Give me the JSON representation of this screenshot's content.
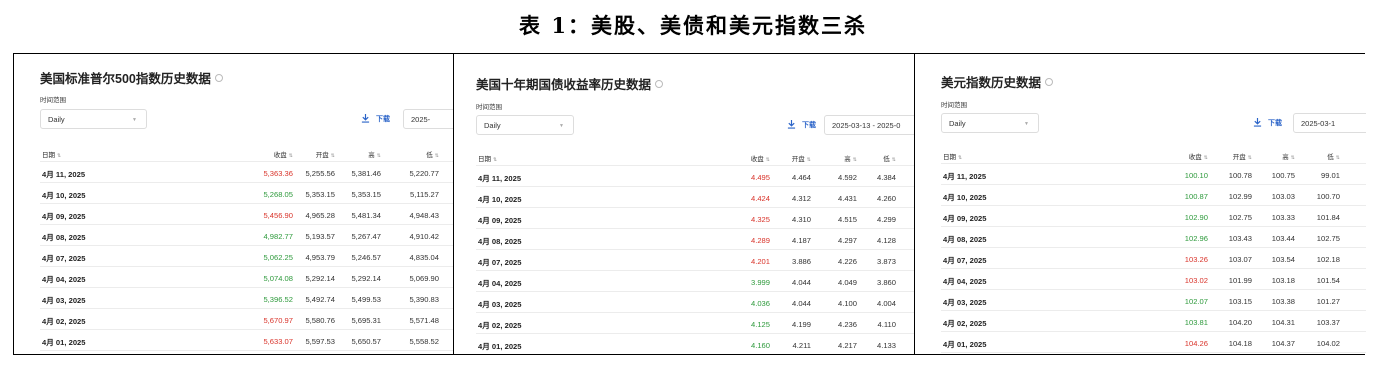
{
  "page_title": "表 1：美股、美债和美元指数三杀",
  "colors": {
    "up": "#d9342b",
    "down": "#2e9a3c",
    "link": "#2a63c8"
  },
  "panels": [
    {
      "title": "美国标准普尔500指数历史数据",
      "range_label": "时间范围",
      "range_value": "Daily",
      "download_label": "下载",
      "date_range": "2025-",
      "columns": [
        "日期",
        "收盘",
        "开盘",
        "高",
        "低"
      ],
      "rows": [
        {
          "date": "4月 11, 2025",
          "close": "5,363.36",
          "open": "5,255.56",
          "high": "5,381.46",
          "low": "5,220.77",
          "trend": "up"
        },
        {
          "date": "4月 10, 2025",
          "close": "5,268.05",
          "open": "5,353.15",
          "high": "5,353.15",
          "low": "5,115.27",
          "trend": "down"
        },
        {
          "date": "4月 09, 2025",
          "close": "5,456.90",
          "open": "4,965.28",
          "high": "5,481.34",
          "low": "4,948.43",
          "trend": "up"
        },
        {
          "date": "4月 08, 2025",
          "close": "4,982.77",
          "open": "5,193.57",
          "high": "5,267.47",
          "low": "4,910.42",
          "trend": "down"
        },
        {
          "date": "4月 07, 2025",
          "close": "5,062.25",
          "open": "4,953.79",
          "high": "5,246.57",
          "low": "4,835.04",
          "trend": "down"
        },
        {
          "date": "4月 04, 2025",
          "close": "5,074.08",
          "open": "5,292.14",
          "high": "5,292.14",
          "low": "5,069.90",
          "trend": "down"
        },
        {
          "date": "4月 03, 2025",
          "close": "5,396.52",
          "open": "5,492.74",
          "high": "5,499.53",
          "low": "5,390.83",
          "trend": "down"
        },
        {
          "date": "4月 02, 2025",
          "close": "5,670.97",
          "open": "5,580.76",
          "high": "5,695.31",
          "low": "5,571.48",
          "trend": "up"
        },
        {
          "date": "4月 01, 2025",
          "close": "5,633.07",
          "open": "5,597.53",
          "high": "5,650.57",
          "low": "5,558.52",
          "trend": "up"
        }
      ]
    },
    {
      "title": "美国十年期国债收益率历史数据",
      "range_label": "时间范围",
      "range_value": "Daily",
      "download_label": "下载",
      "date_range": "2025-03-13 - 2025-0",
      "columns": [
        "日期",
        "收盘",
        "开盘",
        "高",
        "低"
      ],
      "rows": [
        {
          "date": "4月 11, 2025",
          "close": "4.495",
          "open": "4.464",
          "high": "4.592",
          "low": "4.384",
          "trend": "up"
        },
        {
          "date": "4月 10, 2025",
          "close": "4.424",
          "open": "4.312",
          "high": "4.431",
          "low": "4.260",
          "trend": "up"
        },
        {
          "date": "4月 09, 2025",
          "close": "4.325",
          "open": "4.310",
          "high": "4.515",
          "low": "4.299",
          "trend": "up"
        },
        {
          "date": "4月 08, 2025",
          "close": "4.289",
          "open": "4.187",
          "high": "4.297",
          "low": "4.128",
          "trend": "up"
        },
        {
          "date": "4月 07, 2025",
          "close": "4.201",
          "open": "3.886",
          "high": "4.226",
          "low": "3.873",
          "trend": "up"
        },
        {
          "date": "4月 04, 2025",
          "close": "3.999",
          "open": "4.044",
          "high": "4.049",
          "low": "3.860",
          "trend": "down"
        },
        {
          "date": "4月 03, 2025",
          "close": "4.036",
          "open": "4.044",
          "high": "4.100",
          "low": "4.004",
          "trend": "down"
        },
        {
          "date": "4月 02, 2025",
          "close": "4.125",
          "open": "4.199",
          "high": "4.236",
          "low": "4.110",
          "trend": "down"
        },
        {
          "date": "4月 01, 2025",
          "close": "4.160",
          "open": "4.211",
          "high": "4.217",
          "low": "4.133",
          "trend": "down"
        }
      ]
    },
    {
      "title": "美元指数历史数据",
      "range_label": "时间范围",
      "range_value": "Daily",
      "download_label": "下载",
      "date_range": "2025-03-1",
      "columns": [
        "日期",
        "收盘",
        "开盘",
        "高",
        "低"
      ],
      "rows": [
        {
          "date": "4月 11, 2025",
          "close": "100.10",
          "open": "100.78",
          "high": "100.75",
          "low": "99.01",
          "trend": "down"
        },
        {
          "date": "4月 10, 2025",
          "close": "100.87",
          "open": "102.99",
          "high": "103.03",
          "low": "100.70",
          "trend": "down"
        },
        {
          "date": "4月 09, 2025",
          "close": "102.90",
          "open": "102.75",
          "high": "103.33",
          "low": "101.84",
          "trend": "down"
        },
        {
          "date": "4月 08, 2025",
          "close": "102.96",
          "open": "103.43",
          "high": "103.44",
          "low": "102.75",
          "trend": "down"
        },
        {
          "date": "4月 07, 2025",
          "close": "103.26",
          "open": "103.07",
          "high": "103.54",
          "low": "102.18",
          "trend": "up"
        },
        {
          "date": "4月 04, 2025",
          "close": "103.02",
          "open": "101.99",
          "high": "103.18",
          "low": "101.54",
          "trend": "up"
        },
        {
          "date": "4月 03, 2025",
          "close": "102.07",
          "open": "103.15",
          "high": "103.38",
          "low": "101.27",
          "trend": "down"
        },
        {
          "date": "4月 02, 2025",
          "close": "103.81",
          "open": "104.20",
          "high": "104.31",
          "low": "103.37",
          "trend": "down"
        },
        {
          "date": "4月 01, 2025",
          "close": "104.26",
          "open": "104.18",
          "high": "104.37",
          "low": "104.02",
          "trend": "up"
        }
      ]
    }
  ]
}
